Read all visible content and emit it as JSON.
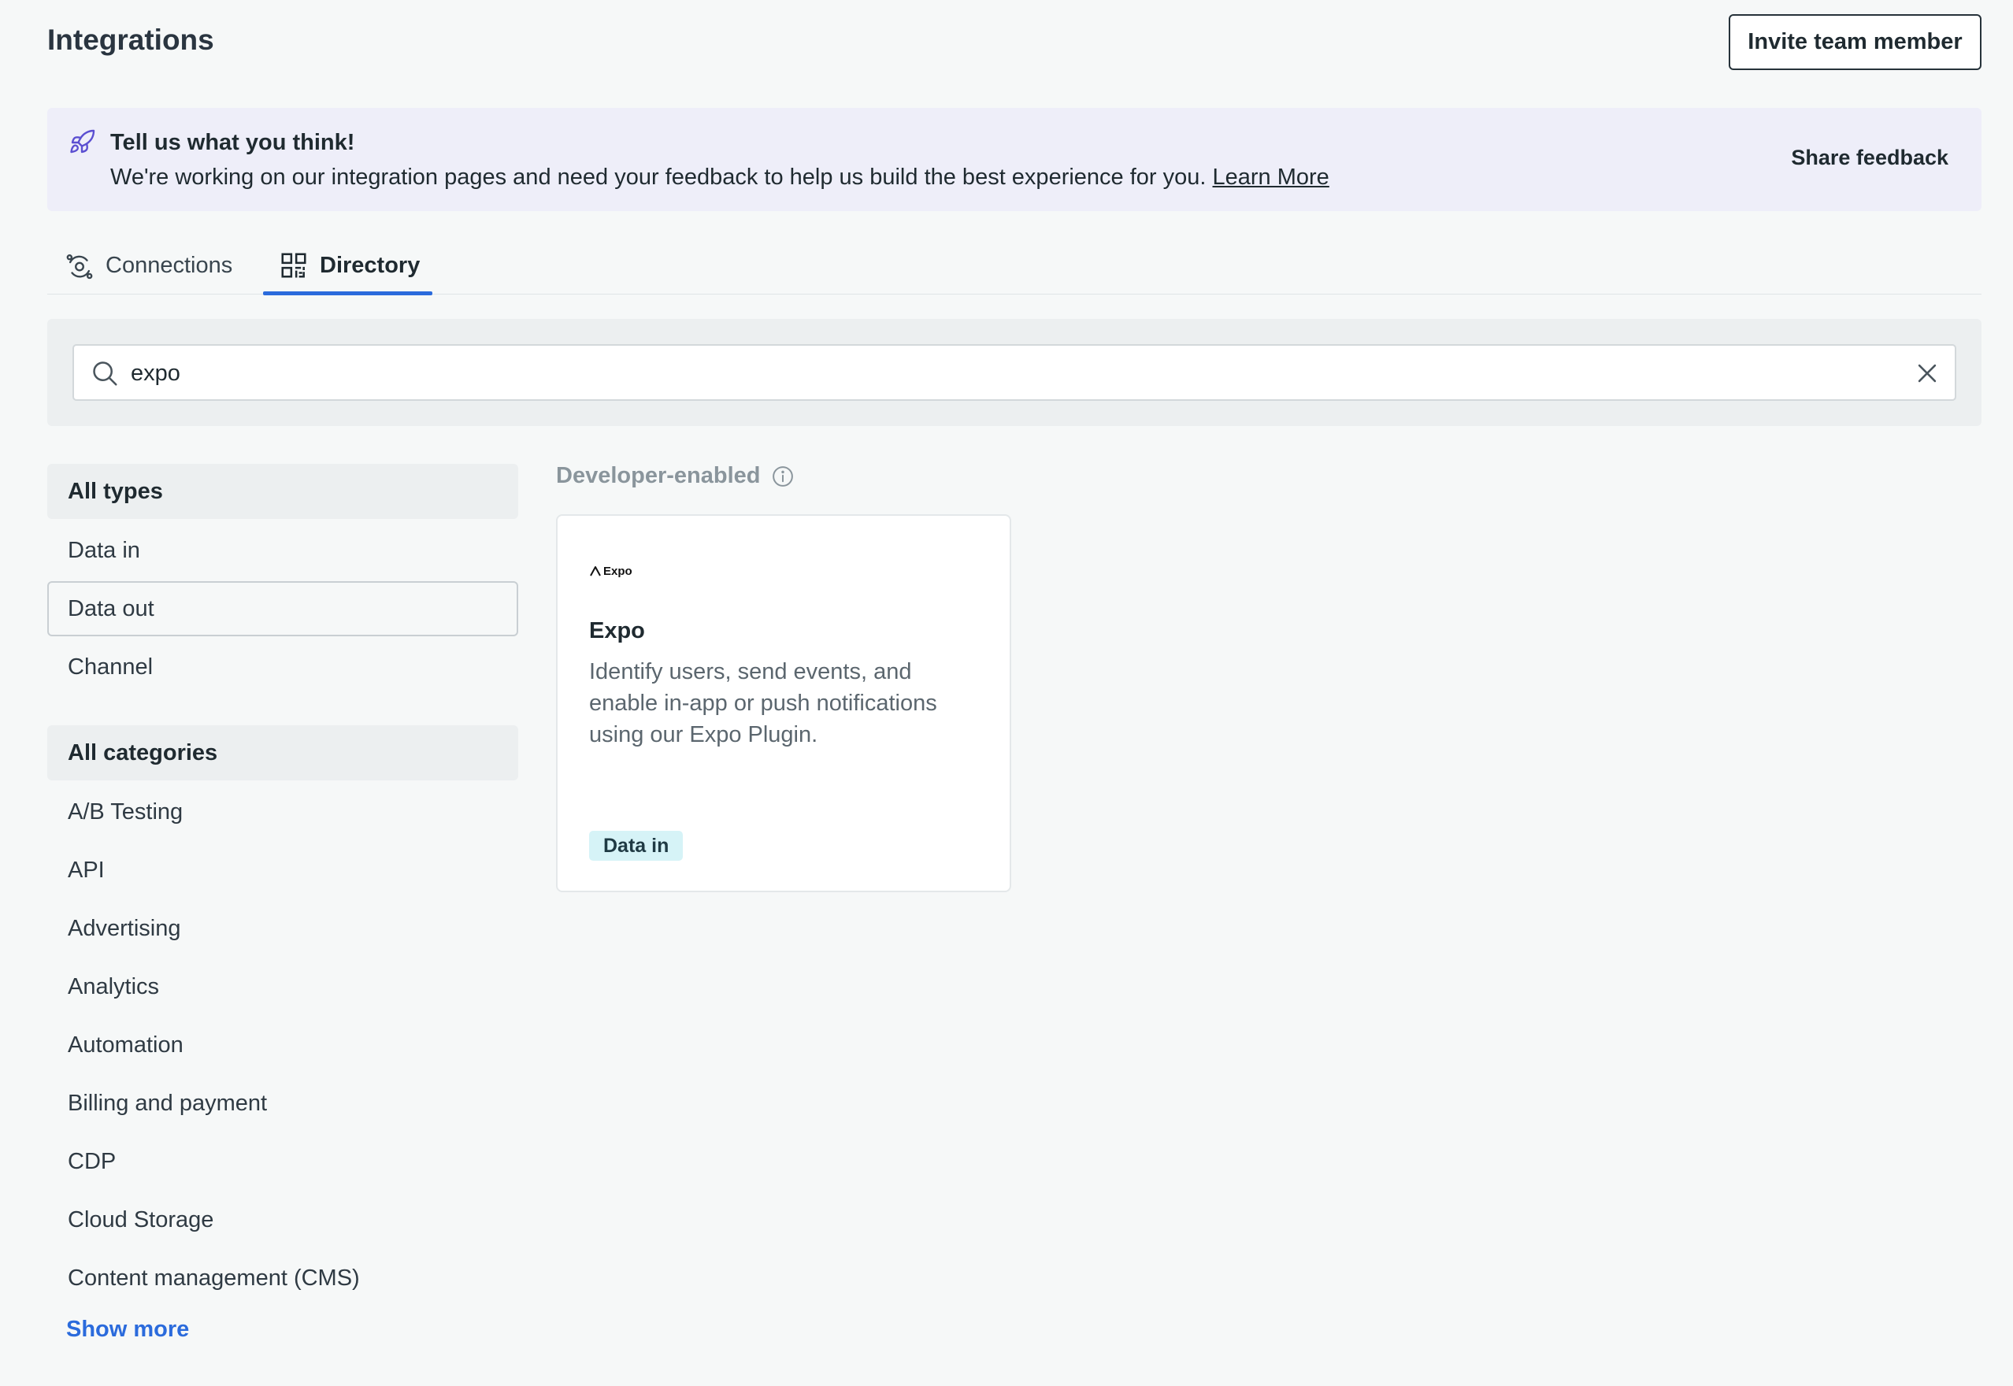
{
  "header": {
    "title": "Integrations",
    "invite_label": "Invite team member"
  },
  "banner": {
    "title": "Tell us what you think!",
    "text": "We're working on our integration pages and need your feedback to help us build the best experience for you.",
    "learn_more": "Learn More",
    "share_label": "Share feedback",
    "icon": "rocket-icon"
  },
  "tabs": [
    {
      "label": "Connections",
      "icon": "connections-icon",
      "active": false
    },
    {
      "label": "Directory",
      "icon": "grid-qr-icon",
      "active": true
    }
  ],
  "search": {
    "value": "expo",
    "placeholder": "",
    "icon": "search-icon",
    "clear_icon": "close-icon"
  },
  "filters": {
    "types_heading": "All types",
    "types": [
      {
        "label": "Data in",
        "selected": false
      },
      {
        "label": "Data out",
        "selected": true
      },
      {
        "label": "Channel",
        "selected": false
      }
    ],
    "categories_heading": "All categories",
    "categories": [
      "A/B Testing",
      "API",
      "Advertising",
      "Analytics",
      "Automation",
      "Billing and payment",
      "CDP",
      "Cloud Storage",
      "Content management (CMS)"
    ],
    "show_more": "Show more"
  },
  "results": {
    "section_label": "Developer-enabled",
    "cards": [
      {
        "logo_text": "Expo",
        "title": "Expo",
        "description": "Identify users, send events, and enable in-app or push notifications using our Expo Plugin.",
        "badge": "Data in"
      }
    ]
  },
  "colors": {
    "accent": "#2b6bdc",
    "banner_bg": "#eeeef9",
    "badge_bg": "#d6f3f7",
    "page_bg": "#f6f8f8"
  }
}
